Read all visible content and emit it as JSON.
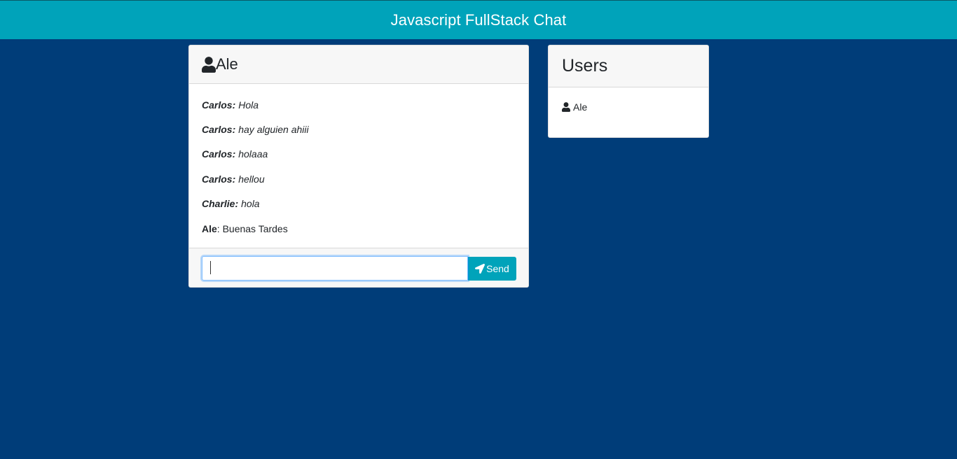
{
  "app": {
    "title": "Javascript FullStack Chat"
  },
  "chat": {
    "current_user": "Ale",
    "messages": [
      {
        "author": "Carlos:",
        "text": "Hola"
      },
      {
        "author": "Carlos:",
        "text": "hay alguien ahiii"
      },
      {
        "author": "Carlos:",
        "text": "holaaa"
      },
      {
        "author": "Carlos:",
        "text": "hellou"
      },
      {
        "author": "Charlie:",
        "text": "hola"
      },
      {
        "author": "Ale",
        "text": ": Buenas Tardes"
      }
    ],
    "input_value": "",
    "send_label": "Send"
  },
  "users": {
    "title": "Users",
    "list": [
      {
        "name": "Ale"
      }
    ]
  },
  "colors": {
    "background": "#003d79",
    "accent": "#00a3ba"
  },
  "icons": {
    "header_user": "user-icon",
    "send": "paper-plane-icon",
    "list_user": "user-icon"
  }
}
